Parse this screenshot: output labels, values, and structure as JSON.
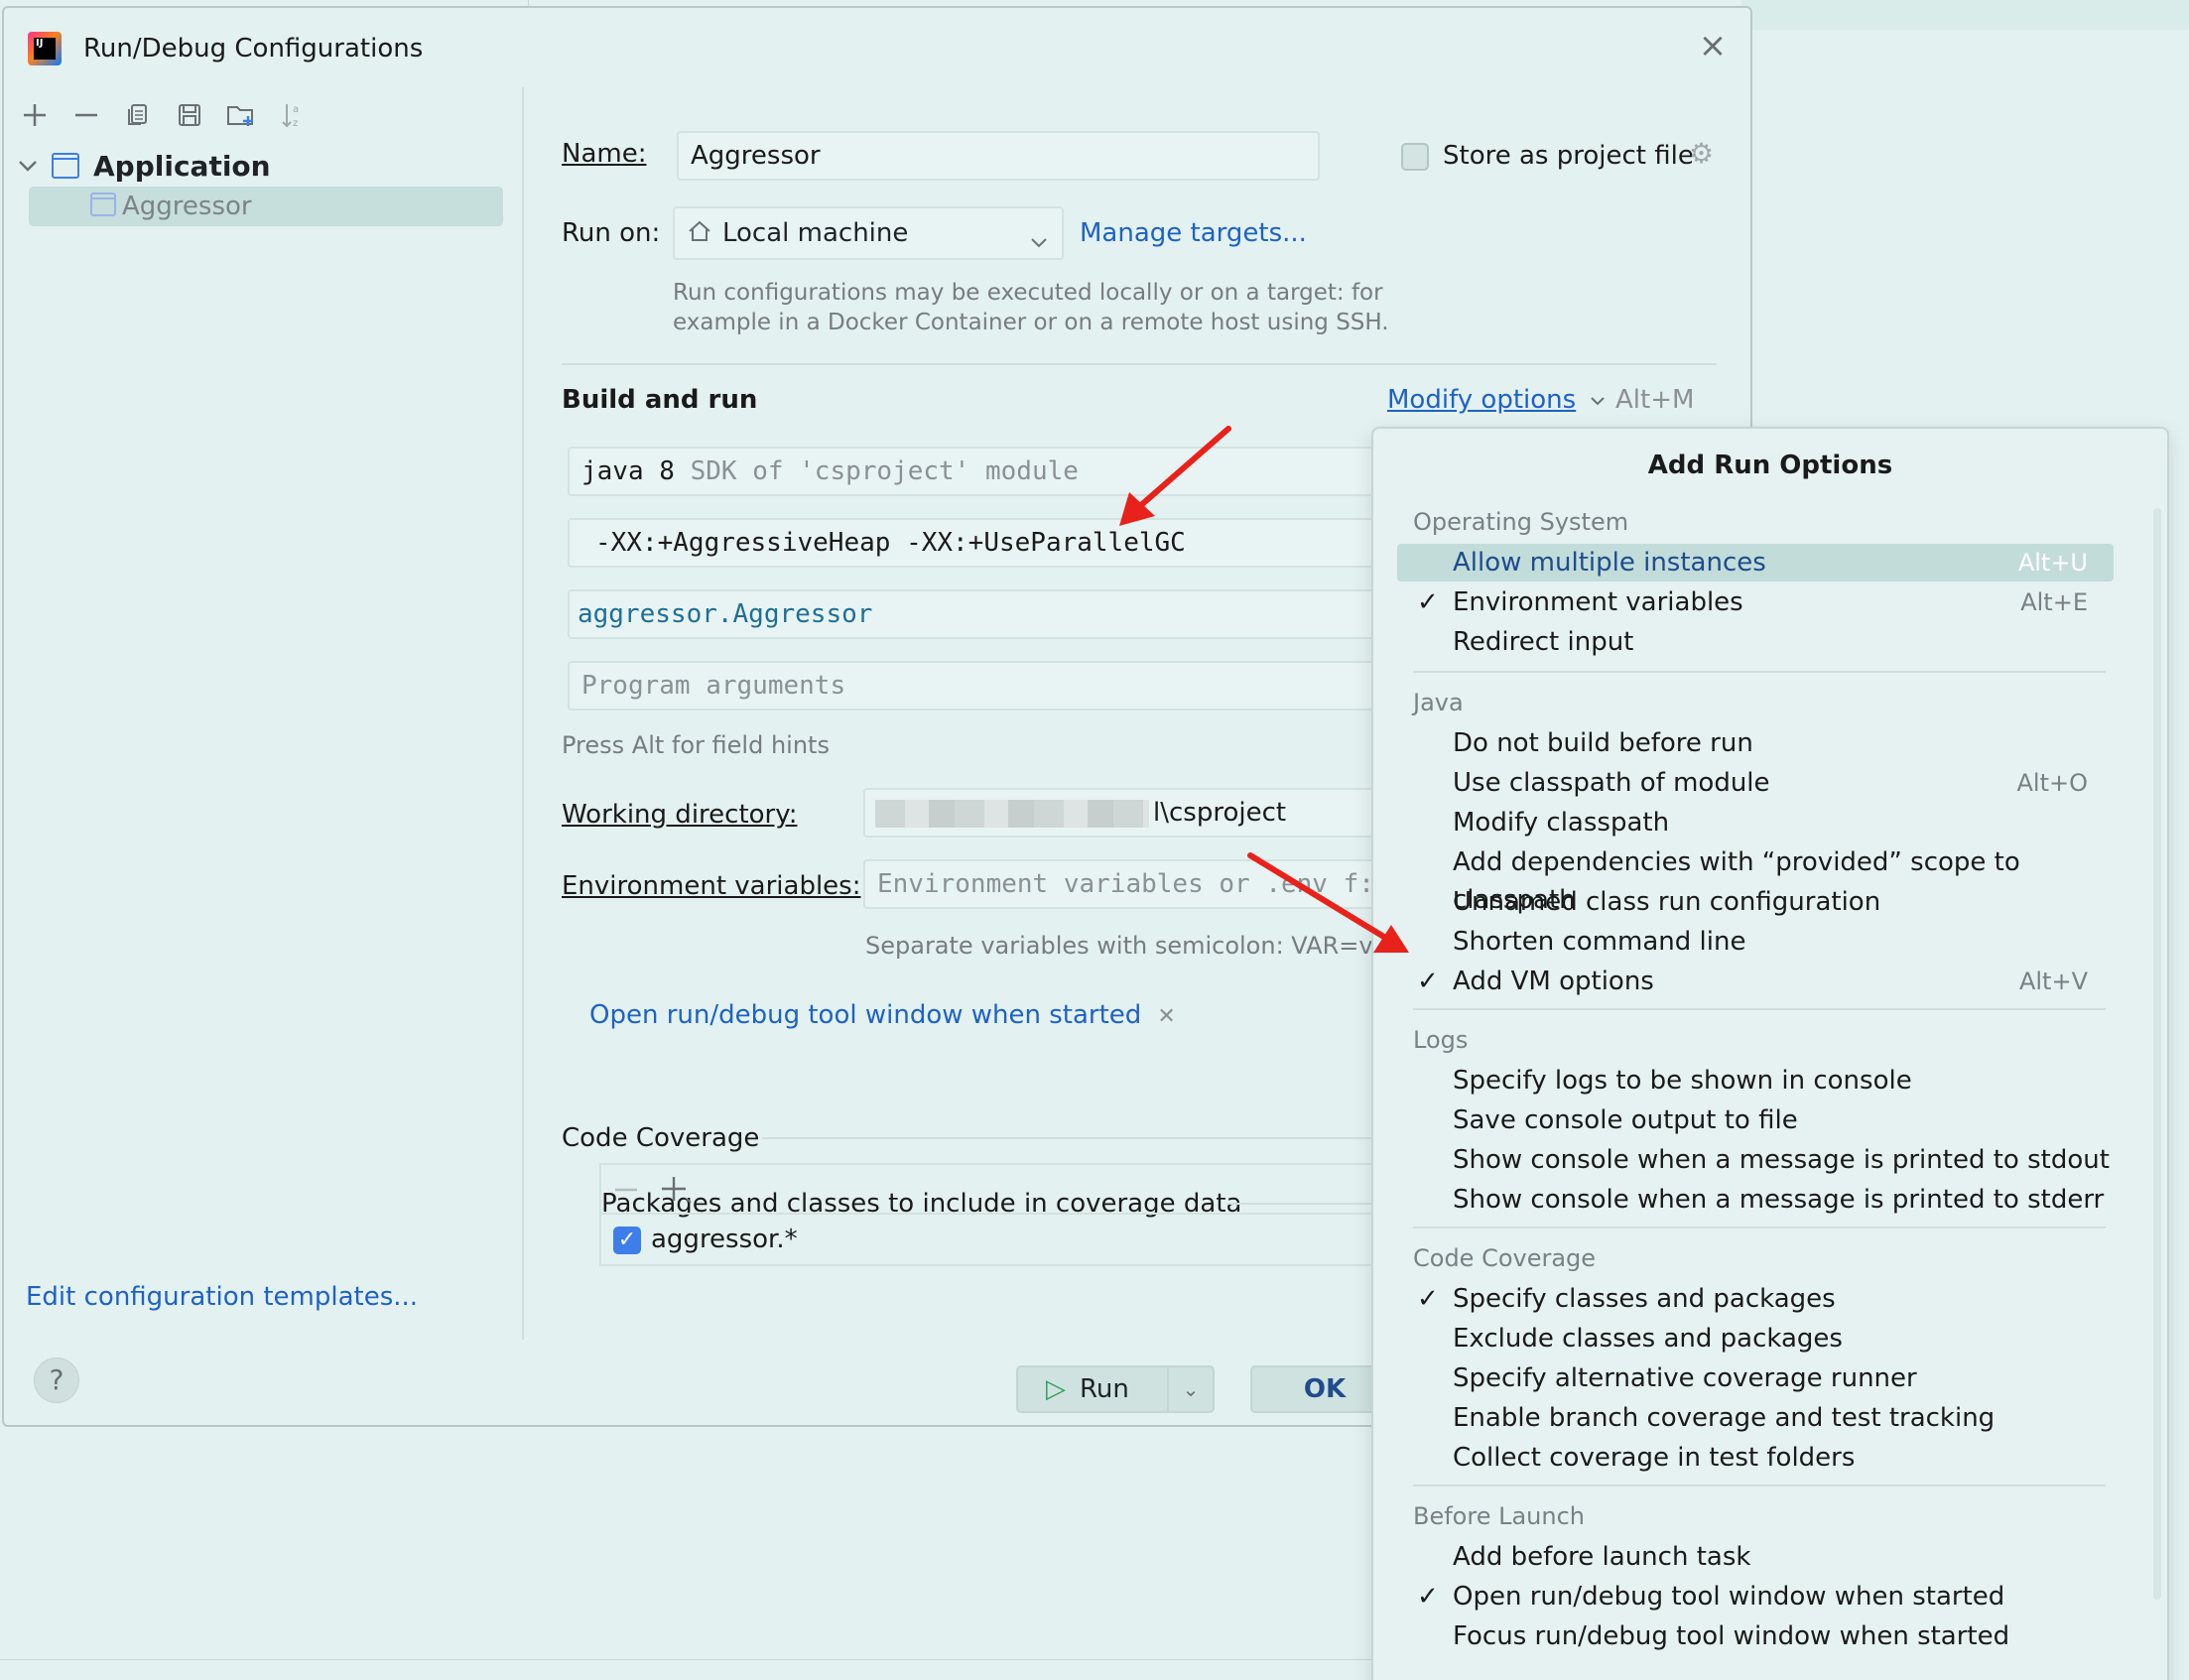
{
  "dialog": {
    "title": "Run/Debug Configurations",
    "close_icon": "close-icon"
  },
  "sidebar": {
    "toolbar_icons": [
      "add-icon",
      "remove-icon",
      "copy-icon",
      "save-icon",
      "new-folder-icon",
      "sort-icon"
    ],
    "tree_root": "Application",
    "tree_child": "Aggressor",
    "edit_templates": "Edit configuration templates..."
  },
  "form": {
    "name_label": "Name:",
    "name_value": "Aggressor",
    "store_label": "Store as project file",
    "run_on_label": "Run on:",
    "run_on_value": "Local machine",
    "manage_targets": "Manage targets...",
    "run_on_hint_1": "Run configurations may be executed locally or on a target: for",
    "run_on_hint_2": "example in a Docker Container or on a remote host using SSH.",
    "build_run_title": "Build and run",
    "modify_options": "Modify options",
    "modify_shortcut": "Alt+M",
    "sdk_prefix": "java 8",
    "sdk_suffix": "SDK of 'csproject' module",
    "vm_options": "-XX:+AggressiveHeap -XX:+UseParallelGC",
    "main_class": "aggressor.Aggressor",
    "program_args_placeholder": "Program arguments",
    "field_hints": "Press Alt for field hints",
    "working_dir_label": "Working directory:",
    "working_dir_value": "l\\csproject",
    "env_label": "Environment variables:",
    "env_placeholder": "Environment variables or .env f:",
    "env_hint": "Separate variables with semicolon: VAR=valu",
    "open_tool_window_chip": "Open run/debug tool window when started",
    "code_coverage_title": "Code Coverage",
    "coverage_include_label": "Packages and classes to include in coverage data",
    "coverage_item": "aggressor.*"
  },
  "footer": {
    "help": "?",
    "run": "Run",
    "ok": "OK"
  },
  "popup": {
    "title": "Add Run Options",
    "groups": [
      {
        "name": "Operating System",
        "items": [
          {
            "label": "Allow multiple instances",
            "shortcut": "Alt+U",
            "checked": false,
            "selected": true
          },
          {
            "label": "Environment variables",
            "shortcut": "Alt+E",
            "checked": true
          },
          {
            "label": "Redirect input",
            "shortcut": "",
            "checked": false
          }
        ]
      },
      {
        "name": "Java",
        "items": [
          {
            "label": "Do not build before run",
            "shortcut": "",
            "checked": false
          },
          {
            "label": "Use classpath of module",
            "shortcut": "Alt+O",
            "checked": false
          },
          {
            "label": "Modify classpath",
            "shortcut": "",
            "checked": false
          },
          {
            "label": "Add dependencies with “provided” scope to classpath",
            "shortcut": "",
            "checked": false
          },
          {
            "label": "Unnamed class run configuration",
            "shortcut": "",
            "checked": false
          },
          {
            "label": "Shorten command line",
            "shortcut": "",
            "checked": false
          },
          {
            "label": "Add VM options",
            "shortcut": "Alt+V",
            "checked": true
          }
        ]
      },
      {
        "name": "Logs",
        "items": [
          {
            "label": "Specify logs to be shown in console",
            "shortcut": "",
            "checked": false
          },
          {
            "label": "Save console output to file",
            "shortcut": "",
            "checked": false
          },
          {
            "label": "Show console when a message is printed to stdout",
            "shortcut": "",
            "checked": false
          },
          {
            "label": "Show console when a message is printed to stderr",
            "shortcut": "",
            "checked": false
          }
        ]
      },
      {
        "name": "Code Coverage",
        "items": [
          {
            "label": "Specify classes and packages",
            "shortcut": "",
            "checked": true
          },
          {
            "label": "Exclude classes and packages",
            "shortcut": "",
            "checked": false
          },
          {
            "label": "Specify alternative coverage runner",
            "shortcut": "",
            "checked": false
          },
          {
            "label": "Enable branch coverage and test tracking",
            "shortcut": "",
            "checked": false
          },
          {
            "label": "Collect coverage in test folders",
            "shortcut": "",
            "checked": false
          }
        ]
      },
      {
        "name": "Before Launch",
        "items": [
          {
            "label": "Add before launch task",
            "shortcut": "",
            "checked": false
          },
          {
            "label": "Open run/debug tool window when started",
            "shortcut": "",
            "checked": true
          },
          {
            "label": "Focus run/debug tool window when started",
            "shortcut": "",
            "checked": false
          }
        ]
      }
    ]
  },
  "colors": {
    "background": "#e3f1f0",
    "link": "#1e62c4",
    "selection": "#c2dcda",
    "annotation_arrow": "#e8221b"
  }
}
